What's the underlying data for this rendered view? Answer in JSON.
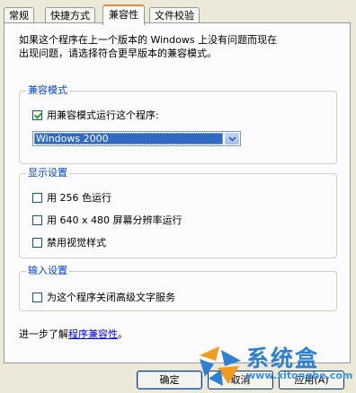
{
  "tabs": [
    {
      "label": "常规"
    },
    {
      "label": "快捷方式"
    },
    {
      "label": "兼容性",
      "active": true
    },
    {
      "label": "文件校验"
    }
  ],
  "intro_text_line1": "如果这个程序在上一个版本的 Windows 上没有问题而现在",
  "intro_text_line2": "出现问题，请选择符合更早版本的兼容模式。",
  "compat_mode": {
    "title": "兼容模式",
    "checkbox_label": "用兼容模式运行这个程序:",
    "checked": true,
    "selected_os": "Windows 2000"
  },
  "display_settings": {
    "title": "显示设置",
    "options": [
      {
        "label": "用 256 色运行",
        "checked": false
      },
      {
        "label": "用 640 x 480 屏幕分辨率运行",
        "checked": false
      },
      {
        "label": "禁用视觉样式",
        "checked": false
      }
    ]
  },
  "input_settings": {
    "title": "输入设置",
    "options": [
      {
        "label": "为这个程序关闭高级文字服务",
        "checked": false
      }
    ]
  },
  "more_info": {
    "prefix": "进一步了解",
    "link": "程序兼容性",
    "suffix": "。"
  },
  "buttons": {
    "ok": "确定",
    "cancel": "取消",
    "apply": "应用(A)"
  },
  "watermark": {
    "text": "系统盒",
    "url": "www.xitonghe.com"
  },
  "colors": {
    "group_title": "#0046d5",
    "selection": "#316ac5",
    "active_tab_accent": "#e68b2c",
    "link": "#0000ff"
  }
}
